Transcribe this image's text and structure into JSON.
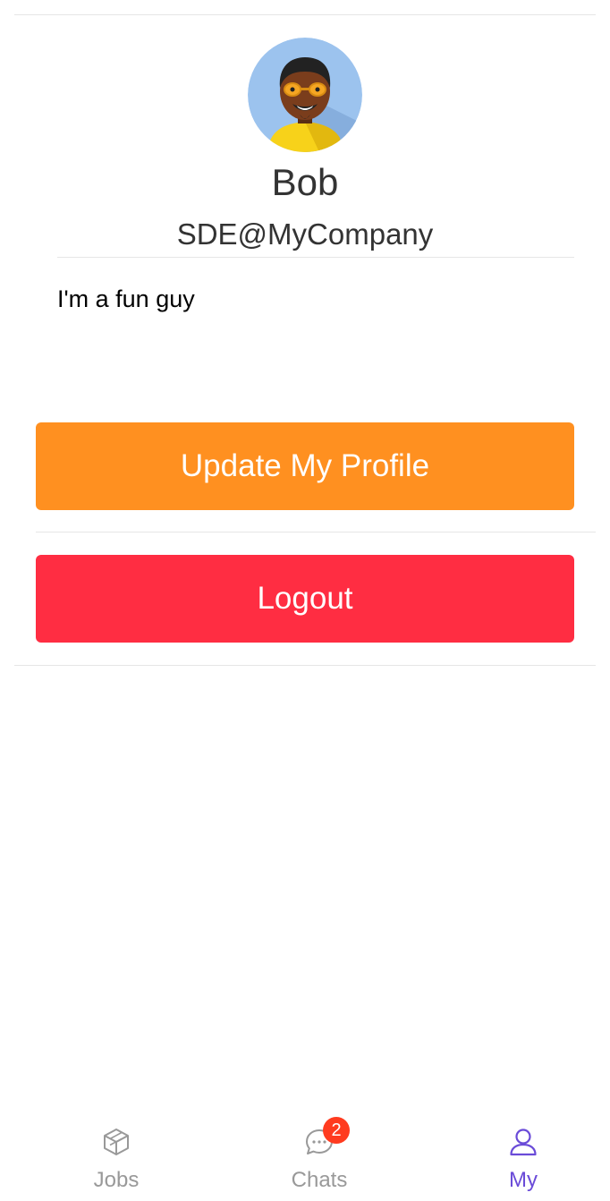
{
  "profile": {
    "avatar_icon": "person-with-glasses-avatar-icon",
    "name": "Bob",
    "title": "SDE@MyCompany",
    "bio": "I'm a fun guy"
  },
  "actions": {
    "update_label": "Update My Profile",
    "logout_label": "Logout"
  },
  "tabbar": {
    "jobs": {
      "label": "Jobs",
      "icon": "cube-icon"
    },
    "chats": {
      "label": "Chats",
      "icon": "chat-bubble-icon",
      "badge": "2"
    },
    "my": {
      "label": "My",
      "icon": "user-icon",
      "active": true
    }
  },
  "colors": {
    "accent": "#6a4bd8",
    "update_button": "#ff9020",
    "logout_button": "#ff2d42",
    "badge": "#ff3b1f"
  }
}
